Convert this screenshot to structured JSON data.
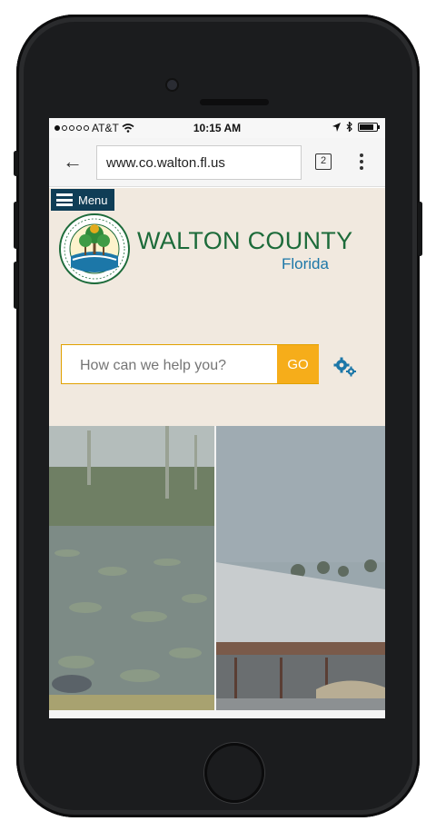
{
  "status_bar": {
    "carrier": "AT&T",
    "time": "10:15 AM",
    "battery_level": 0.85
  },
  "browser": {
    "url": "www.co.walton.fl.us",
    "tab_count": "2",
    "icons": {
      "back": "back-arrow-icon",
      "menu": "kebab-menu-icon"
    }
  },
  "site": {
    "menu_label": "Menu",
    "title": "WALTON COUNTY",
    "subtitle": "Florida",
    "search": {
      "placeholder": "How can we help you?",
      "go_label": "GO"
    }
  },
  "colors": {
    "header_bg": "#f1e9df",
    "title_green": "#1d6b3a",
    "subtitle_blue": "#1c77a8",
    "go_orange": "#f6ad1a",
    "menu_navy": "#0f3d56"
  }
}
